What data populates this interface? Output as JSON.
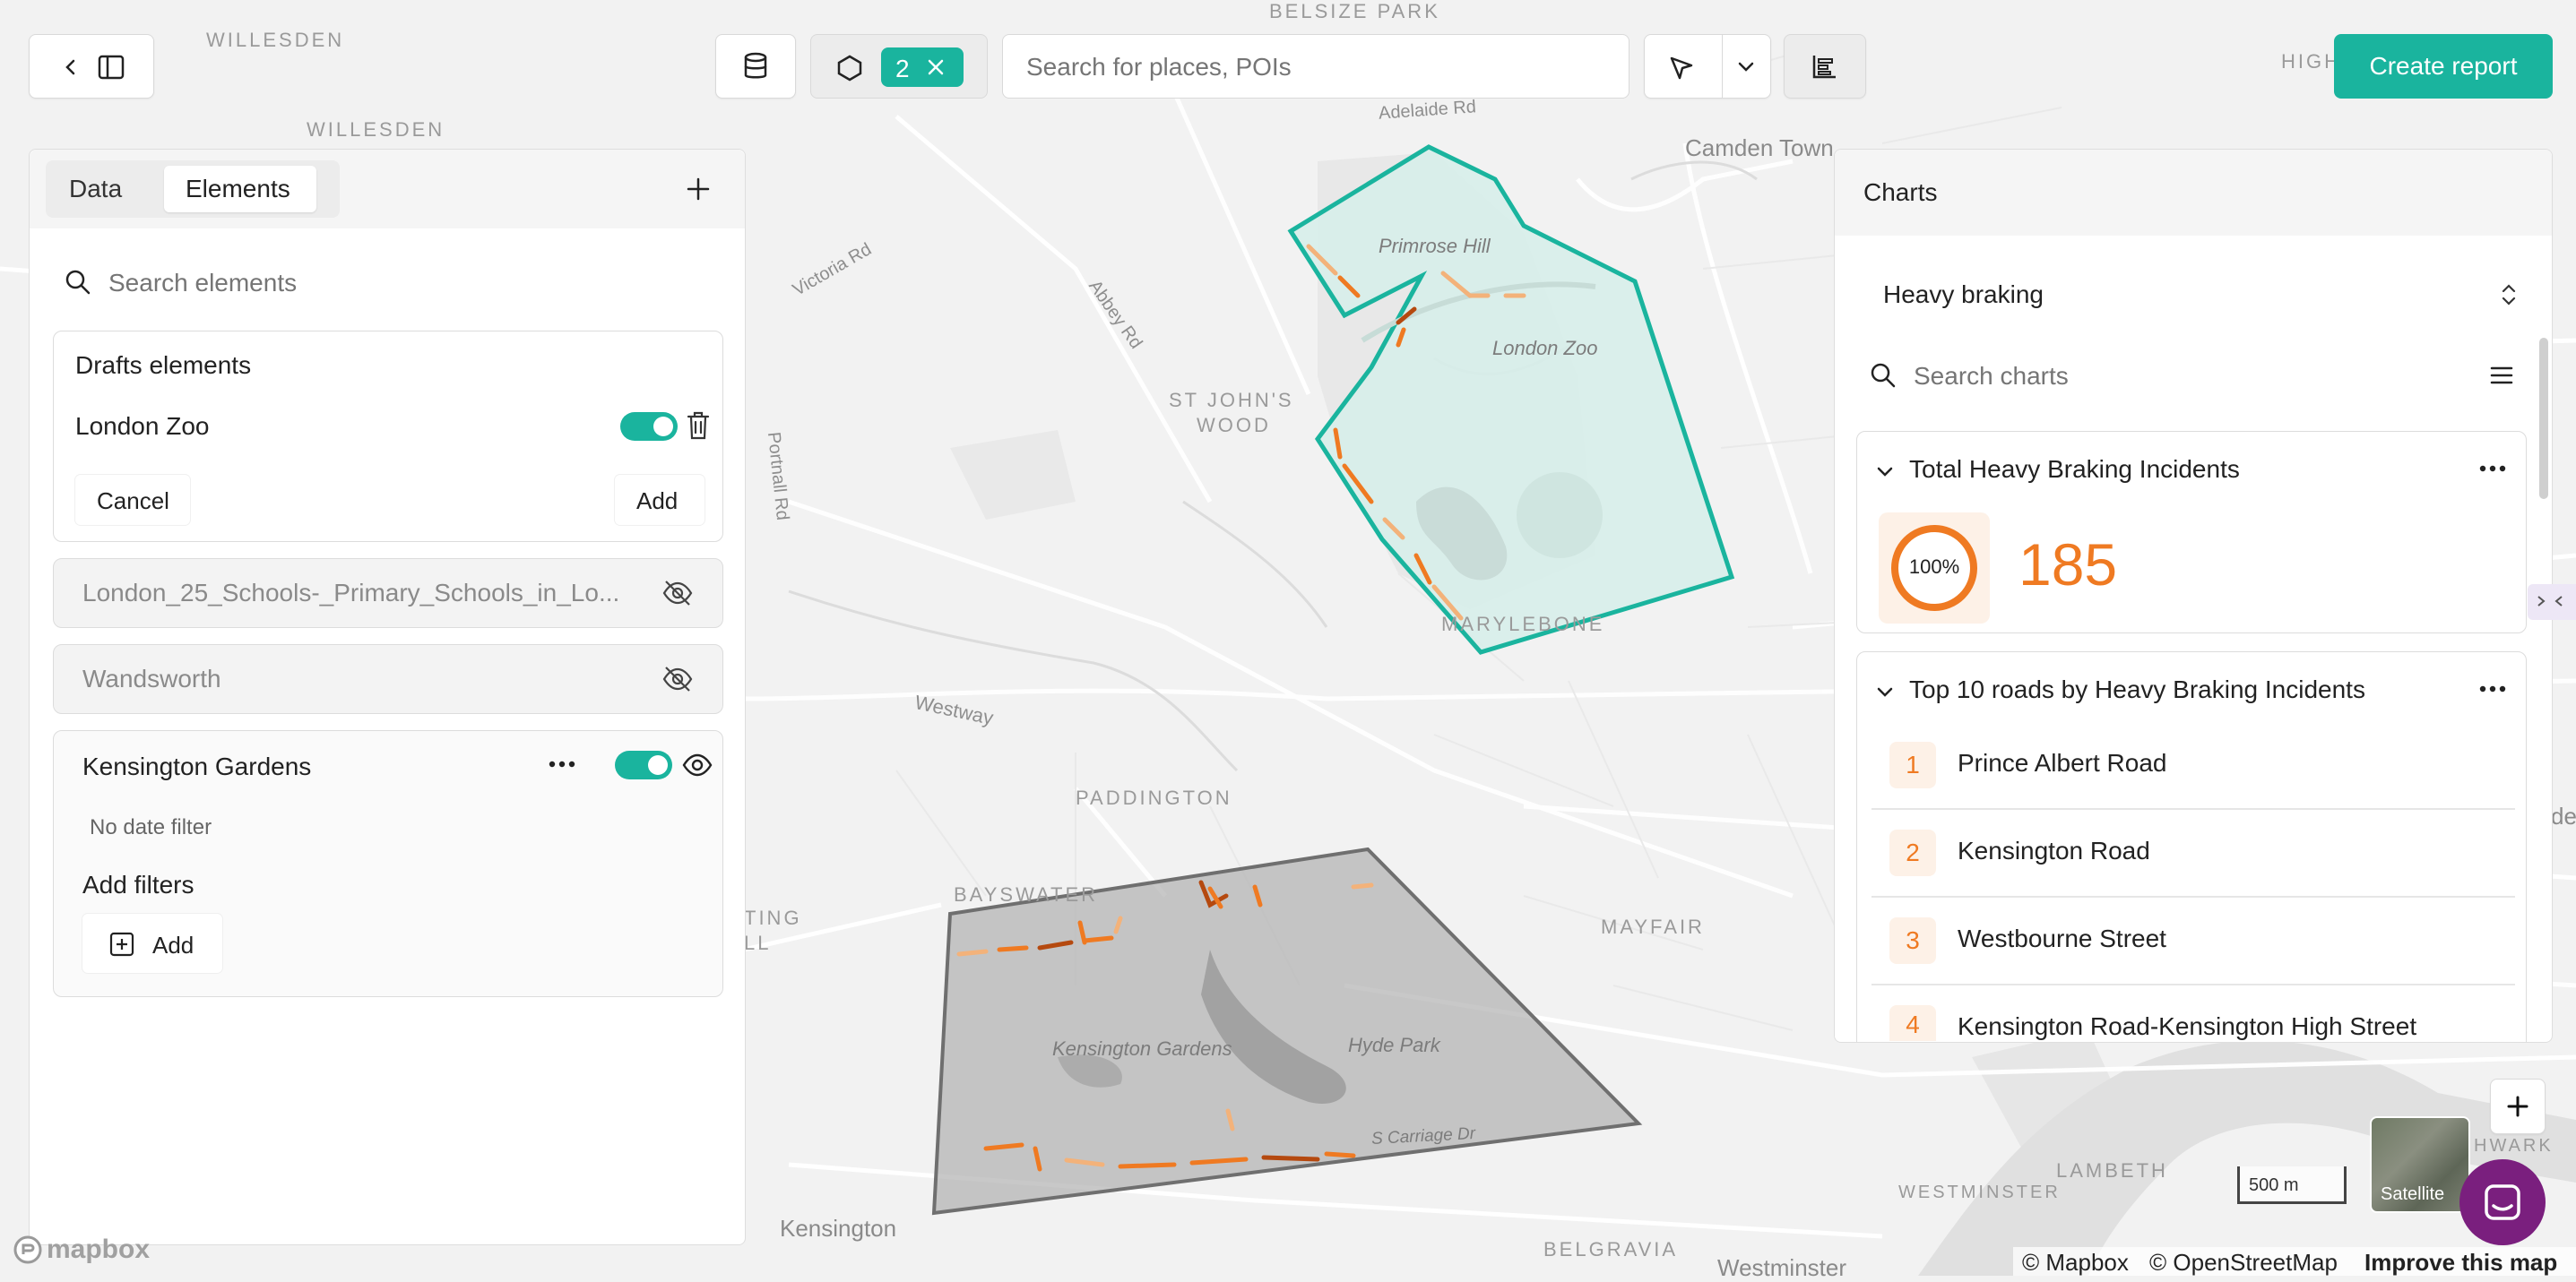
{
  "toolbar": {
    "polygon_count": "2",
    "search_placeholder": "Search for places, POIs",
    "create_report_label": "Create report"
  },
  "left_panel": {
    "tabs": [
      "Data",
      "Elements"
    ],
    "active_tab": "Elements",
    "search_placeholder": "Search elements",
    "drafts": {
      "title": "Drafts elements",
      "item_name": "London Zoo",
      "cancel_label": "Cancel",
      "add_label": "Add"
    },
    "layers": [
      {
        "name": "London_25_Schools-_Primary_Schools_in_Lo...",
        "visible": false
      },
      {
        "name": "Wandsworth",
        "visible": false
      }
    ],
    "kensington": {
      "name": "Kensington Gardens",
      "date_filter": "No date filter",
      "add_filters_title": "Add filters",
      "add_label": "Add"
    }
  },
  "charts_panel": {
    "title": "Charts",
    "metric_select": "Heavy braking",
    "search_placeholder": "Search charts",
    "total_card": {
      "title": "Total Heavy Braking Incidents",
      "percent_label": "100%",
      "value": "185",
      "accent": "#ef7a22"
    },
    "top_roads_card": {
      "title": "Top 10 roads by Heavy Braking Incidents",
      "roads": [
        {
          "rank": "1",
          "name": "Prince Albert Road"
        },
        {
          "rank": "2",
          "name": "Kensington Road"
        },
        {
          "rank": "3",
          "name": "Westbourne Street"
        },
        {
          "rank": "4",
          "name": "Kensington Road-Kensington High Street"
        }
      ]
    }
  },
  "map": {
    "labels": {
      "willesden1": "WILLESDEN",
      "willesden2": "WILLESDEN",
      "belsize_park": "BELSIZE PARK",
      "adelaide_rd": "Adelaide Rd",
      "camden_town": "Camden Town",
      "high": "HIGH",
      "primrose_hill": "Primrose Hill",
      "london_zoo": "London Zoo",
      "victoria_rd": "Victoria Rd",
      "abbey_rd": "Abbey Rd",
      "st_johns": "ST JOHN'S",
      "wood": "WOOD",
      "portnall_rd": "Portnall Rd",
      "marylebone": "MARYLEBONE",
      "westway": "Westway",
      "paddington": "PADDINGTON",
      "bayswater": "BAYSWATER",
      "ting": "TING",
      "ll": "LL",
      "mayfair": "MAYFAIR",
      "kensington_gardens": "Kensington Gardens",
      "hyde_park": "Hyde Park",
      "s_carriage_dr": "S Carriage Dr",
      "kensington": "Kensington",
      "westminster_caps": "WESTMINSTER",
      "lambeth": "LAMBETH",
      "belgravia": "BELGRAVIA",
      "westminster": "Westminster",
      "hwark": "HWARK",
      "de": "de"
    },
    "scale_label": "500 m",
    "satellite_label": "Satellite",
    "mapbox_logo": "mapbox",
    "attribution_mapbox": "© Mapbox",
    "attribution_osm": "© OpenStreetMap",
    "improve_link": "Improve this map",
    "primary_color": "#1ab49e"
  }
}
